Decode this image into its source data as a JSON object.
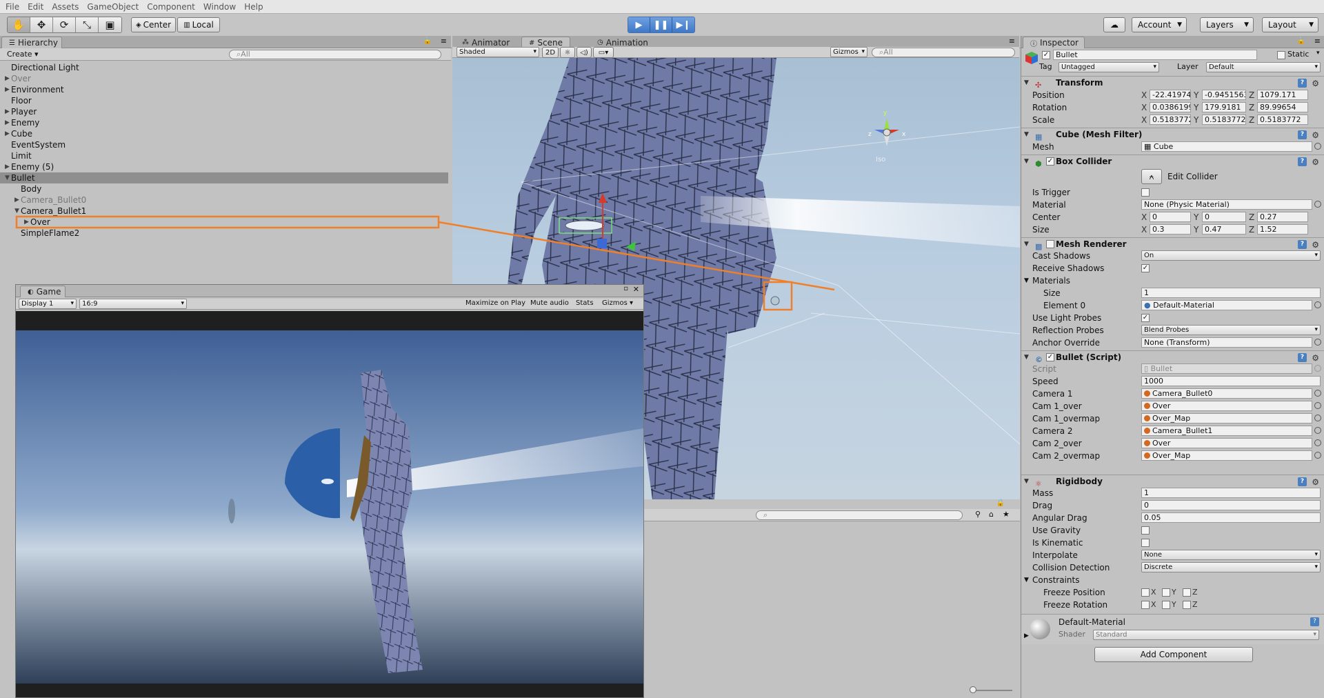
{
  "menu": [
    "File",
    "Edit",
    "Assets",
    "GameObject",
    "Component",
    "Window",
    "Help"
  ],
  "toolbar": {
    "pivot": "Center",
    "space": "Local",
    "cloud": "☁",
    "account": "Account",
    "layers": "Layers",
    "layout": "Layout"
  },
  "hierarchy": {
    "tab": "Hierarchy",
    "create": "Create",
    "search": "All",
    "items": [
      {
        "label": "Directional Light",
        "indent": 0,
        "arrow": ""
      },
      {
        "label": "Over",
        "indent": 0,
        "arrow": "▶",
        "grey": true
      },
      {
        "label": "Environment",
        "indent": 0,
        "arrow": "▶"
      },
      {
        "label": "Floor",
        "indent": 0,
        "arrow": ""
      },
      {
        "label": "Player",
        "indent": 0,
        "arrow": "▶"
      },
      {
        "label": "Enemy",
        "indent": 0,
        "arrow": "▶"
      },
      {
        "label": "Cube",
        "indent": 0,
        "arrow": "▶"
      },
      {
        "label": "EventSystem",
        "indent": 0,
        "arrow": ""
      },
      {
        "label": "Limit",
        "indent": 0,
        "arrow": ""
      },
      {
        "label": "Enemy (5)",
        "indent": 0,
        "arrow": "▶"
      },
      {
        "label": "Bullet",
        "indent": 0,
        "arrow": "▼",
        "selected": true
      },
      {
        "label": "Body",
        "indent": 1,
        "arrow": ""
      },
      {
        "label": "Camera_Bullet0",
        "indent": 1,
        "arrow": "▶",
        "grey": true
      },
      {
        "label": "Camera_Bullet1",
        "indent": 1,
        "arrow": "▼"
      },
      {
        "label": "Over",
        "indent": 2,
        "arrow": "▶"
      },
      {
        "label": "SimpleFlame2",
        "indent": 1,
        "arrow": ""
      }
    ]
  },
  "center_tabs": {
    "animator": "Animator",
    "scene": "Scene",
    "animation": "Animation"
  },
  "scene": {
    "shading": "Shaded",
    "mode2d": "2D",
    "gizmos": "Gizmos",
    "search": "All",
    "persp": "Iso",
    "gizmo_axes": {
      "y": "y",
      "x": "x",
      "z": "z"
    }
  },
  "game": {
    "tab": "Game",
    "display": "Display 1",
    "aspect": "16:9",
    "maximize": "Maximize on Play",
    "mute": "Mute audio",
    "stats": "Stats",
    "gizmos": "Gizmos"
  },
  "inspector": {
    "tab": "Inspector",
    "name": "Bullet",
    "static_label": "Static",
    "tag_label": "Tag",
    "tag": "Untagged",
    "layer_label": "Layer",
    "layer": "Default",
    "transform": {
      "title": "Transform",
      "position_label": "Position",
      "position": [
        "-22.41974",
        "-0.9451563",
        "1079.171"
      ],
      "rotation_label": "Rotation",
      "rotation": [
        "0.03861993",
        "179.9181",
        "89.99654"
      ],
      "scale_label": "Scale",
      "scale": [
        "0.5183772",
        "0.5183772",
        "0.5183772"
      ]
    },
    "mesh_filter": {
      "title": "Cube (Mesh Filter)",
      "mesh_label": "Mesh",
      "mesh": "Cube"
    },
    "box_collider": {
      "title": "Box Collider",
      "edit_collider": "Edit Collider",
      "is_trigger_label": "Is Trigger",
      "material_label": "Material",
      "material": "None (Physic Material)",
      "center_label": "Center",
      "center": [
        "0",
        "0",
        "0.27"
      ],
      "size_label": "Size",
      "size": [
        "0.3",
        "0.47",
        "1.52"
      ]
    },
    "mesh_renderer": {
      "title": "Mesh Renderer",
      "cast_shadows_label": "Cast Shadows",
      "cast_shadows": "On",
      "receive_shadows_label": "Receive Shadows",
      "materials_label": "Materials",
      "size_label": "Size",
      "size": "1",
      "element0_label": "Element 0",
      "element0": "Default-Material",
      "light_probes_label": "Use Light Probes",
      "reflection_probes_label": "Reflection Probes",
      "reflection_probes": "Blend Probes",
      "anchor_override_label": "Anchor Override",
      "anchor_override": "None (Transform)"
    },
    "bullet_script": {
      "title": "Bullet (Script)",
      "script_label": "Script",
      "script": "Bullet",
      "speed_label": "Speed",
      "speed": "1000",
      "camera1_label": "Camera 1",
      "camera1": "Camera_Bullet0",
      "cam1_over_label": "Cam 1_over",
      "cam1_over": "Over",
      "cam1_overmap_label": "Cam 1_overmap",
      "cam1_overmap": "Over_Map",
      "camera2_label": "Camera 2",
      "camera2": "Camera_Bullet1",
      "cam2_over_label": "Cam 2_over",
      "cam2_over": "Over",
      "cam2_overmap_label": "Cam 2_overmap",
      "cam2_overmap": "Over_Map"
    },
    "rigidbody": {
      "title": "Rigidbody",
      "mass_label": "Mass",
      "mass": "1",
      "drag_label": "Drag",
      "drag": "0",
      "angular_drag_label": "Angular Drag",
      "angular_drag": "0.05",
      "use_gravity_label": "Use Gravity",
      "is_kinematic_label": "Is Kinematic",
      "interpolate_label": "Interpolate",
      "interpolate": "None",
      "collision_label": "Collision Detection",
      "collision": "Discrete",
      "constraints_label": "Constraints",
      "freeze_pos_label": "Freeze Position",
      "freeze_rot_label": "Freeze Rotation",
      "x": "X",
      "y": "Y",
      "z": "Z"
    },
    "material": {
      "name": "Default-Material",
      "shader_label": "Shader",
      "shader": "Standard"
    },
    "add_component": "Add Component"
  },
  "colors": {
    "highlight": "#f07f2a",
    "play": "#3f78c8",
    "selected_row": "#8f8f8f"
  }
}
